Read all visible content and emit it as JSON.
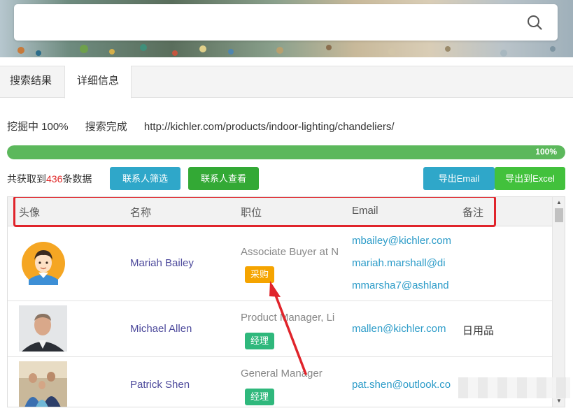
{
  "search": {
    "placeholder": ""
  },
  "tabs": [
    {
      "label": "搜索结果"
    },
    {
      "label": "详细信息"
    }
  ],
  "status": {
    "mining": "挖掘中 100%",
    "state": "搜索完成",
    "url": "http://kichler.com/products/indoor-lighting/chandeliers/"
  },
  "progress": {
    "value": 1.0,
    "label": "100%"
  },
  "toolbar": {
    "count_prefix": "共获取到",
    "count_value": "436",
    "count_suffix": "条数据",
    "filter_label": "联系人筛选",
    "view_label": "联系人查看",
    "export_email_label": "导出Email",
    "export_excel_label": "导出到Excel"
  },
  "table": {
    "headers": [
      "头像",
      "名称",
      "职位",
      "Email",
      "备注"
    ],
    "rows": [
      {
        "name": "Mariah Bailey",
        "position": "Associate Buyer at N",
        "tag": "采购",
        "emails": [
          "mbailey@kichler.com",
          "mariah.marshall@di",
          "mmarsha7@ashland"
        ],
        "note": ""
      },
      {
        "name": "Michael Allen",
        "position": "Product Manager, Li",
        "tag": "经理",
        "emails": [
          "mallen@kichler.com"
        ],
        "note": "日用品"
      },
      {
        "name": "Patrick Shen",
        "position": "General Manager",
        "tag": "经理",
        "emails": [
          "pat.shen@outlook.co"
        ],
        "note": ""
      }
    ]
  },
  "colors": {
    "accent_blue": "#2fa7c9",
    "accent_green": "#33a935",
    "highlight_red": "#e0242b",
    "tag_orange": "#f5a400",
    "tag_green": "#2fb87c"
  }
}
